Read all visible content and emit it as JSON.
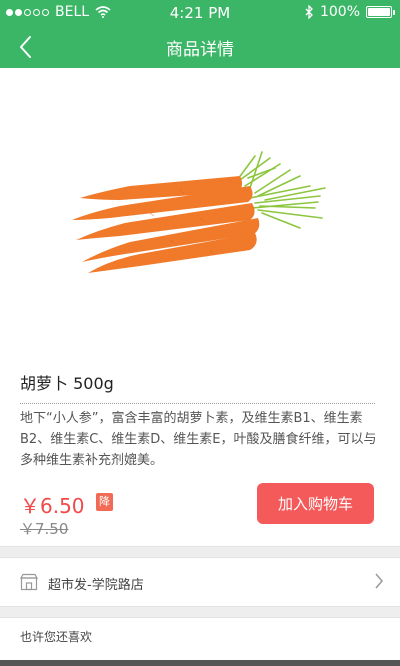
{
  "status_bar": {
    "carrier": "BELL",
    "time": "4:21 PM",
    "battery": "100%",
    "signal_dots_filled": 2,
    "signal_dots_total": 5,
    "battery_level": 1.0
  },
  "nav": {
    "title": "商品详情",
    "back_icon": "chevron-left-icon"
  },
  "product": {
    "image_subject": "carrots",
    "name": "胡萝卜 500g",
    "description": "地下“小人参”，富含丰富的胡萝卜素，及维生素B1、维生素B2、维生素C、维生素D、维生素E，叶酸及膳食纤维，可以与多种维生素补充剂媲美。",
    "current_price": "￥6.50",
    "discount_badge": "降",
    "original_price": "￥7.50",
    "cart_button": "加入购物车"
  },
  "store": {
    "name": "超市发-学院路店",
    "icon": "store-icon"
  },
  "recommend": {
    "title": "也许您还喜欢"
  },
  "colors": {
    "header": "#3bb667",
    "price": "#f04a4a",
    "cart_button": "#f45a5a",
    "carrot": "#f07a2a",
    "carrot_leaves": "#8cc63f"
  }
}
